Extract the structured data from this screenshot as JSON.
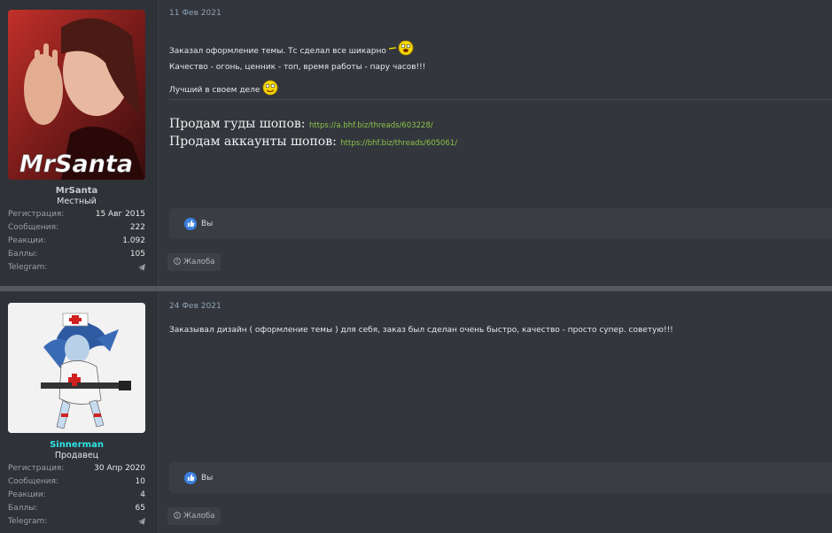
{
  "posts": [
    {
      "user": {
        "name": "MrSanta",
        "title": "Местный",
        "avatar_text": "MrSanta",
        "stats": [
          {
            "label": "Регистрация:",
            "value": "15 Авг 2015"
          },
          {
            "label": "Сообщения:",
            "value": "222"
          },
          {
            "label": "Реакции:",
            "value": "1.092"
          },
          {
            "label": "Баллы:",
            "value": "105"
          },
          {
            "label": "Telegram:",
            "value": ""
          }
        ]
      },
      "date": "11 Фев 2021",
      "body": {
        "line1": "Заказал оформление темы. Тс сделал все шикарно",
        "line2": "Качество - огонь, ценник - топ, время работы - пару часов!!!",
        "line3": "Лучший в своем деле"
      },
      "signature": [
        {
          "text": "Продам гуды шопов:",
          "link": "https://a.bhf.biz/threads/603228/"
        },
        {
          "text": "Продам аккаунты шопов:",
          "link": "https://bhf.biz/threads/605061/"
        }
      ],
      "reactions_label": "Вы",
      "report_label": "Жалоба"
    },
    {
      "user": {
        "name": "Sinnerman",
        "title": "Продавец",
        "stats": [
          {
            "label": "Регистрация:",
            "value": "30 Апр 2020"
          },
          {
            "label": "Сообщения:",
            "value": "10"
          },
          {
            "label": "Реакции:",
            "value": "4"
          },
          {
            "label": "Баллы:",
            "value": "65"
          },
          {
            "label": "Telegram:",
            "value": ""
          }
        ]
      },
      "date": "24 Фев 2021",
      "body": {
        "line1": "Заказывал дизайн ( оформление темы ) для себя, заказ был сделан очень быстро, качество - просто супер. советую!!!"
      },
      "reactions_label": "Вы",
      "report_label": "Жалоба"
    }
  ],
  "colors": {
    "accent_link": "#8bc34a",
    "seller_name": "#2ee6e6",
    "like_blue": "#3a7fe0"
  }
}
